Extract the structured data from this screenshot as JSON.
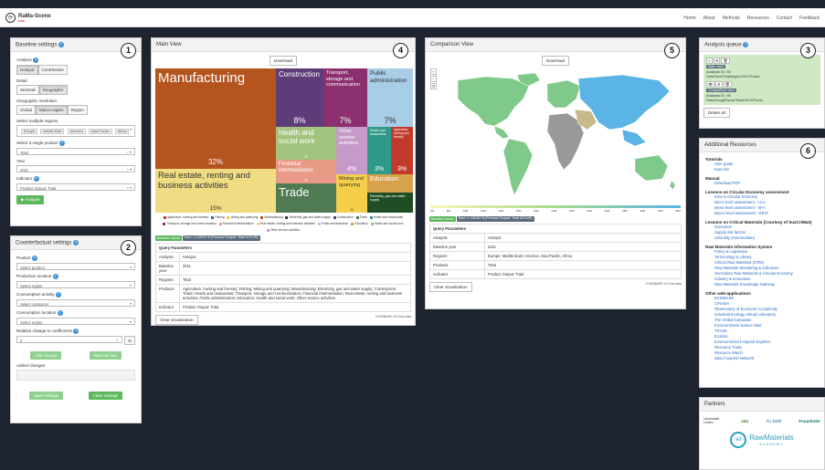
{
  "app": {
    "logo_text": "RaMa-Scene",
    "logo_sub": "beta",
    "nav": [
      "Home",
      "About",
      "Methods",
      "Resources",
      "Contact",
      "Feedback"
    ]
  },
  "baseline": {
    "title": "Baseline settings",
    "number": "1",
    "analysis_label": "Analysis",
    "analysis_opts": [
      "Hotspot",
      "Contribution"
    ],
    "detail_label": "Detail",
    "detail_opts": [
      "Sectoral",
      "Geographic"
    ],
    "geo_label": "Geographic resolution",
    "geo_opts": [
      "Global",
      "Macro-region",
      "Region"
    ],
    "regions_label": "Select multiple regions",
    "regions_tags": [
      "Europe",
      "Middle-East",
      "America",
      "Asia-Pacific",
      "Africa"
    ],
    "product_label": "Select a single product",
    "product_value": "Total",
    "year_label": "Year",
    "year_value": "2011",
    "indicator_label": "Indicator",
    "indicator_value": "Product Output: Total",
    "analyse_btn": "Analyse"
  },
  "counterfactual": {
    "title": "Counterfactual settings",
    "number": "2",
    "product_label": "Product",
    "product_ph": "Select product",
    "prodloc_label": "Production location",
    "prodloc_ph": "Select region",
    "consact_label": "Consumption activity",
    "consact_ph": "Select consumer",
    "consloc_label": "Consumption location",
    "consloc_ph": "Select region",
    "relchange_label": "Relative change to coefficients",
    "relchange_value": "0",
    "unit": "%",
    "add_btn": "Add change",
    "remove_btn": "Remove last",
    "added_label": "Added changes",
    "save_btn": "Save settings",
    "clear_btn": "Clear settings"
  },
  "main_view": {
    "title": "Main View",
    "number": "4",
    "download": "Download",
    "baseline_badge": "Baseline results",
    "sum_badge": "Sum: 1.1051E+8 (Product Output: Total M.EUR)",
    "query_params": "Query Parameters",
    "rows": [
      [
        "Analysis",
        "Hotspot"
      ],
      [
        "Baseline year",
        "2011"
      ],
      [
        "Regions",
        "Total"
      ],
      [
        "Products",
        "Agriculture, hunting and forestry; Fishing; Mining and quarrying; Manufacturing; Electricity, gas and water supply; Construction; Trade; Hotels and restaurants; Transport, storage and communication; Financial intermediation; Real estate, renting and business activities; Public administration; Education; Health and social work; Other service activities"
      ],
      [
        "Indicator",
        "Product Output: Total"
      ]
    ],
    "clear_viz": "Clear visualization",
    "source": "EXIOBASE v3.3 ind data"
  },
  "chart_data": {
    "type": "treemap",
    "cells": [
      {
        "name": "Manufacturing",
        "value": "32%",
        "color": "#b5541f"
      },
      {
        "name": "Real estate, renting and business activities",
        "value": "15%",
        "color": "#f0dc82"
      },
      {
        "name": "Construction",
        "value": "8%",
        "color": "#5e3c7a"
      },
      {
        "name": "Transport, storage and communication",
        "value": "7%",
        "color": "#8b2f6e"
      },
      {
        "name": "Public administration",
        "value": "7%",
        "color": "#a8cde6"
      },
      {
        "name": "Health and social work",
        "value": "%",
        "color": "#a3c47e"
      },
      {
        "name": "Other service activities",
        "value": "4%",
        "color": "#c59ac9"
      },
      {
        "name": "Hotels and restaurants",
        "value": "3%",
        "color": "#2f9a8a"
      },
      {
        "name": "Agriculture, hunting and forestry",
        "value": "3%",
        "color": "#c23b2a"
      },
      {
        "name": "Financial intermediation",
        "value": "%",
        "color": "#e89a86"
      },
      {
        "name": "Trade",
        "value": "",
        "color": "#4f7a52"
      },
      {
        "name": "Mining and quarrying",
        "value": "%",
        "color": "#f5cf4a"
      },
      {
        "name": "Education",
        "value": "",
        "color": "#d8a24a"
      },
      {
        "name": "Electricity, gas and water supply",
        "value": "",
        "color": "#1f4d24"
      }
    ],
    "legend": [
      {
        "name": "Agriculture, hunting and forestry",
        "color": "#c23b2a"
      },
      {
        "name": "Fishing",
        "color": "#1f6fb0"
      },
      {
        "name": "Mining and quarrying",
        "color": "#f5cf4a"
      },
      {
        "name": "Manufacturing",
        "color": "#b5541f"
      },
      {
        "name": "Electricity, gas and water supply",
        "color": "#1f4d24"
      },
      {
        "name": "Construction",
        "color": "#5e3c7a"
      },
      {
        "name": "Trade",
        "color": "#4f7a52"
      },
      {
        "name": "Hotels and restaurants",
        "color": "#2f9a8a"
      },
      {
        "name": "Transport, storage and communication",
        "color": "#8b2f6e"
      },
      {
        "name": "Financial intermediation",
        "color": "#e89a86"
      },
      {
        "name": "Real estate, renting and business activities",
        "color": "#f0dc82"
      },
      {
        "name": "Public administration",
        "color": "#a8cde6"
      },
      {
        "name": "Education",
        "color": "#d8a24a"
      },
      {
        "name": "Health and social work",
        "color": "#a3c47e"
      },
      {
        "name": "Other service activities",
        "color": "#c59ac9"
      }
    ]
  },
  "comparison_view": {
    "title": "Comparison View",
    "number": "5",
    "download": "Download",
    "scale": [
      "5M",
      "8M",
      "10M",
      "12M",
      "14M",
      "16M",
      "18M",
      "20M",
      "22M",
      "24M",
      "26M",
      "28M",
      "30M",
      "32M",
      "34M"
    ],
    "baseline_badge": "Baseline results",
    "sum_badge": "Sum: 1.1051E+8 (Product Output: Total M.EUR)",
    "query_params": "Query Parameters",
    "rows": [
      [
        "Analysis",
        "Hotspot"
      ],
      [
        "Baseline year",
        "2011"
      ],
      [
        "Regions",
        "Europe; Middle-East; America; Asia-Pacific; Africa"
      ],
      [
        "Products",
        "Total"
      ],
      [
        "Indicator",
        "Product Output: Total"
      ]
    ],
    "clear_viz": "Clear visualization",
    "source": "EXIOBASE v3.3 ind data",
    "map_colors": {
      "ocean": "#ffffff",
      "land": "#7fc98a",
      "highlight": "#5ab4e5",
      "gray": "#999999",
      "mid": "#c8b98a"
    }
  },
  "queue": {
    "title": "Analysis queue",
    "number": "3",
    "items": [
      {
        "badge": "Main view",
        "id": "Analysis ID: 95",
        "path": "Hots/Sect/Total/Agric/2011/Produ"
      },
      {
        "badge": "Comparison view",
        "id": "Analysis ID: 96",
        "path": "Hots/Geog/Europ/Total/2011/Produ"
      }
    ],
    "delete_all": "Delete all"
  },
  "resources": {
    "title": "Additional Resources",
    "number": "6",
    "sections": [
      {
        "head": "Tutorials",
        "links": [
          "User guide",
          "Exercise"
        ]
      },
      {
        "head": "Manual",
        "links": [
          "Download PDF"
        ]
      },
      {
        "head": "Lessons on Circular Economy assessment",
        "links": [
          "Intro to Circular Economy",
          "Micro-level assessment - LCA",
          "Meso-level assessment - SFA",
          "Macro-level assessment - EEIO"
        ]
      },
      {
        "head": "Lessons on Critical Materials (Courtesy of SusCritMat)",
        "links": [
          "Scenarios",
          "Supply risk factors",
          "Criticality (intermediate)"
        ]
      },
      {
        "head": "Raw Materials Information System",
        "links": [
          "Policy & Legislation",
          "Terminology & Library",
          "Critical Raw Materials (CRM)",
          "Raw Materials Monitoring & Indicators",
          "Secondary Raw Materials & Circular Economy",
          "Industry & Innovation",
          "Raw Materials Knowledge Gateway"
        ]
      },
      {
        "head": "Other web-applications",
        "links": [
          "EXIOBASE",
          "CIRAMA",
          "Observatory of Economic Complexity",
          "Industrial Ecology Virtual Laboratory",
          "The Global Calculator",
          "Environmental Justice Atlas",
          "TRASE",
          "Ecolizer",
          "Environmental Footprint Explorer",
          "Resource Trade",
          "Resource Watch",
          "Data Footprint Network"
        ]
      }
    ]
  },
  "partners": {
    "title": "Partners",
    "logos": [
      "Universiteit Leiden",
      "vito",
      "TU Delft",
      "Fraunhofer"
    ],
    "eit_text": "RawMaterials",
    "eit_sub": "ACADEMY",
    "eit_mark": "eit"
  }
}
